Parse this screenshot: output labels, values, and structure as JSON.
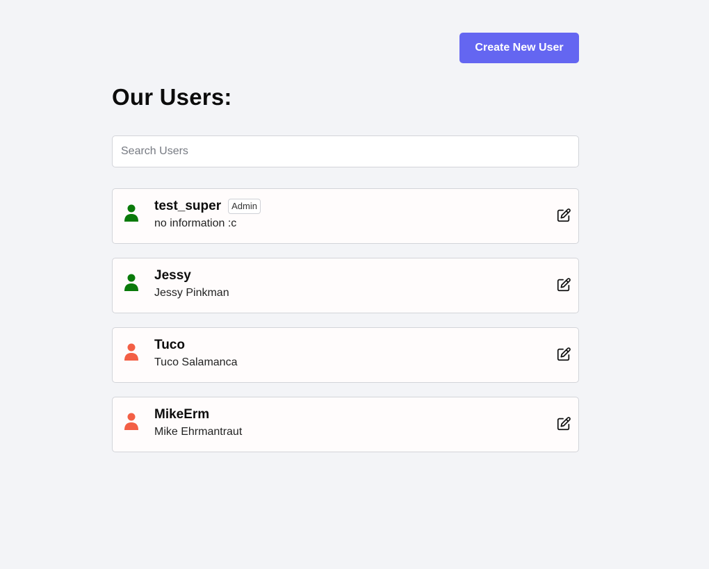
{
  "header": {
    "create_button_label": "Create New User",
    "title": "Our Users:"
  },
  "search": {
    "placeholder": "Search Users",
    "value": ""
  },
  "users": [
    {
      "username": "test_super",
      "badge": "Admin",
      "full_name": "no information :c",
      "status_color": "#0a7a0a"
    },
    {
      "username": "Jessy",
      "badge": "",
      "full_name": "Jessy Pinkman",
      "status_color": "#0a7a0a"
    },
    {
      "username": "Tuco",
      "badge": "",
      "full_name": "Tuco Salamanca",
      "status_color": "#f35f45"
    },
    {
      "username": "MikeErm",
      "badge": "",
      "full_name": "Mike Ehrmantraut",
      "status_color": "#f35f45"
    }
  ],
  "colors": {
    "accent": "#6466f1",
    "background": "#f3f4f7",
    "active_user": "#0a7a0a",
    "inactive_user": "#f35f45"
  },
  "icons": {
    "avatar": "user-icon",
    "edit": "edit-icon"
  }
}
